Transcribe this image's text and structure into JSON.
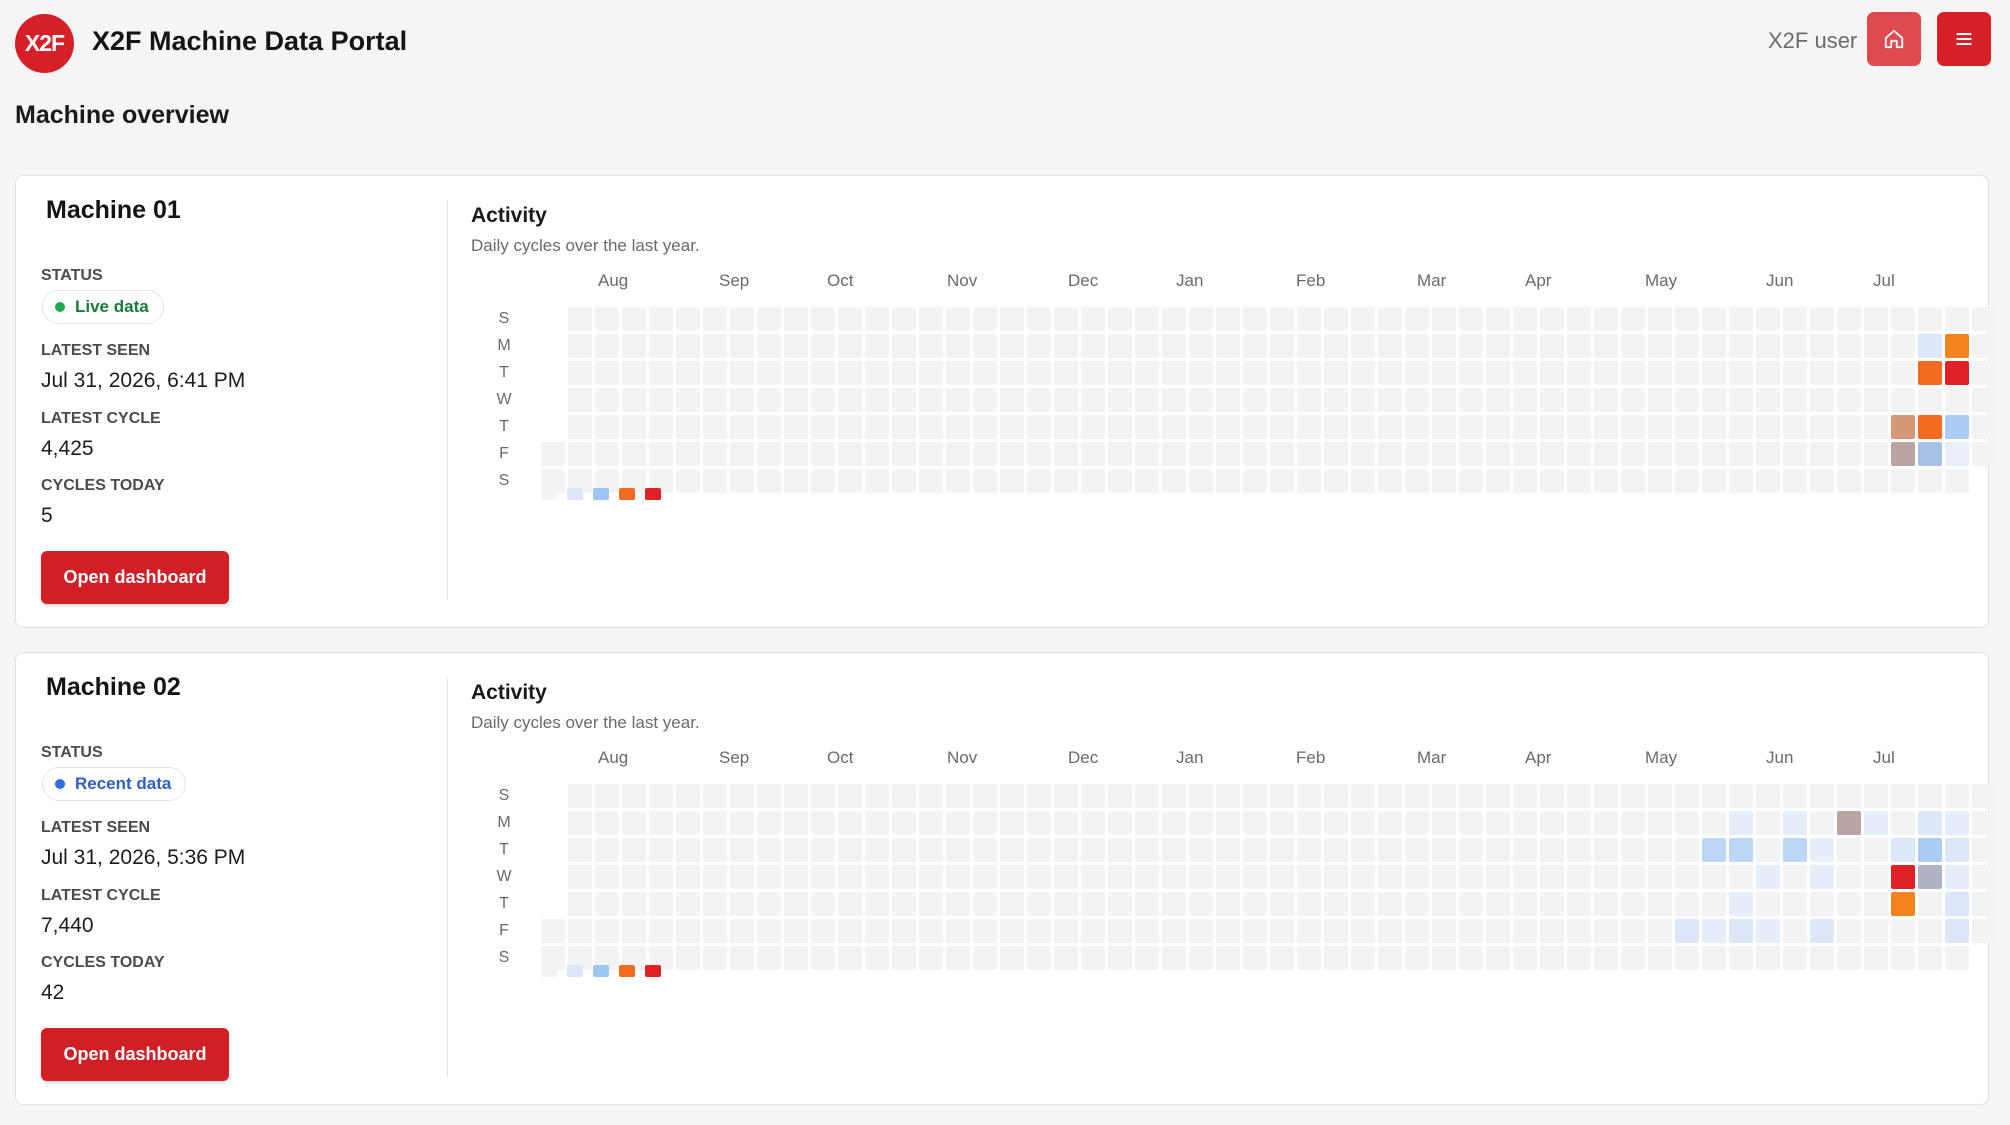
{
  "app": {
    "logo_text": "X2F",
    "title": "X2F Machine Data Portal",
    "user": "X2F user"
  },
  "header_icons": {
    "home": "home-icon",
    "menu": "menu-icon"
  },
  "page": {
    "heading": "Machine overview"
  },
  "activity": {
    "title": "Activity",
    "subtitle": "Daily cycles over the last year.",
    "months": [
      "Aug",
      "Sep",
      "Oct",
      "Nov",
      "Dec",
      "Jan",
      "Feb",
      "Mar",
      "Apr",
      "May",
      "Jun",
      "Jul"
    ],
    "weekdays": [
      "S",
      "M",
      "T",
      "W",
      "T",
      "F",
      "S"
    ],
    "legend_colors": [
      "#f2f3f5",
      "#dce8fa",
      "#9ec6f3",
      "#f26b21",
      "#de2127"
    ]
  },
  "machines": [
    {
      "name": "Machine 01",
      "status_label": "STATUS",
      "status": "Live data",
      "status_color": "#22a94f",
      "status_text_color": "#1a7a3c",
      "latest_seen_label": "LATEST SEEN",
      "latest_seen": "Jul 31, 2026, 6:41 PM",
      "latest_cycle_label": "LATEST CYCLE",
      "latest_cycle": "4,425",
      "cycles_today_label": "CYCLES TODAY",
      "cycles_today": "5",
      "button": "Open dashboard",
      "active_days": [
        {
          "week": 51,
          "day": 1,
          "color": "#dce8fa"
        },
        {
          "week": 52,
          "day": 1,
          "color": "#f2831f"
        },
        {
          "week": 51,
          "day": 2,
          "color": "#f26b21"
        },
        {
          "week": 52,
          "day": 2,
          "color": "#de2127"
        },
        {
          "week": 50,
          "day": 4,
          "color": "#d69876"
        },
        {
          "week": 51,
          "day": 4,
          "color": "#f26b21"
        },
        {
          "week": 52,
          "day": 4,
          "color": "#a9cdf5"
        },
        {
          "week": 50,
          "day": 5,
          "color": "#bca3a3"
        },
        {
          "week": 51,
          "day": 5,
          "color": "#a6c0e6"
        },
        {
          "week": 52,
          "day": 5,
          "color": "#e9eef8"
        }
      ]
    },
    {
      "name": "Machine 02",
      "status_label": "STATUS",
      "status": "Recent data",
      "status_color": "#2f6fdc",
      "status_text_color": "#2f5fc4",
      "latest_seen_label": "LATEST SEEN",
      "latest_seen": "Jul 31, 2026, 5:36 PM",
      "latest_cycle_label": "LATEST CYCLE",
      "latest_cycle": "7,440",
      "cycles_today_label": "CYCLES TODAY",
      "cycles_today": "42",
      "button": "Open dashboard",
      "active_days": [
        {
          "week": 44,
          "day": 1,
          "color": "#e6eefb"
        },
        {
          "week": 46,
          "day": 1,
          "color": "#e6eefb"
        },
        {
          "week": 48,
          "day": 1,
          "color": "#bca3a3"
        },
        {
          "week": 49,
          "day": 1,
          "color": "#e6eefb"
        },
        {
          "week": 51,
          "day": 1,
          "color": "#dce8fa"
        },
        {
          "week": 52,
          "day": 1,
          "color": "#e6eefb"
        },
        {
          "week": 43,
          "day": 2,
          "color": "#bcd6f7"
        },
        {
          "week": 44,
          "day": 2,
          "color": "#bcd6f7"
        },
        {
          "week": 46,
          "day": 2,
          "color": "#bcd6f7"
        },
        {
          "week": 47,
          "day": 2,
          "color": "#e6eefb"
        },
        {
          "week": 50,
          "day": 2,
          "color": "#dce8fa"
        },
        {
          "week": 51,
          "day": 2,
          "color": "#a9cdf5"
        },
        {
          "week": 52,
          "day": 2,
          "color": "#dce8fa"
        },
        {
          "week": 45,
          "day": 3,
          "color": "#e6eefb"
        },
        {
          "week": 47,
          "day": 3,
          "color": "#e6eefb"
        },
        {
          "week": 50,
          "day": 3,
          "color": "#de2127"
        },
        {
          "week": 51,
          "day": 3,
          "color": "#b0b3c4"
        },
        {
          "week": 52,
          "day": 3,
          "color": "#e6eefb"
        },
        {
          "week": 44,
          "day": 4,
          "color": "#e6eefb"
        },
        {
          "week": 50,
          "day": 4,
          "color": "#f2831f"
        },
        {
          "week": 52,
          "day": 4,
          "color": "#dce8fa"
        },
        {
          "week": 42,
          "day": 5,
          "color": "#dce8fa"
        },
        {
          "week": 43,
          "day": 5,
          "color": "#e6eefb"
        },
        {
          "week": 44,
          "day": 5,
          "color": "#dce8fa"
        },
        {
          "week": 45,
          "day": 5,
          "color": "#e6eefb"
        },
        {
          "week": 47,
          "day": 5,
          "color": "#dce8fa"
        },
        {
          "week": 52,
          "day": 5,
          "color": "#dce8fa"
        }
      ]
    }
  ]
}
